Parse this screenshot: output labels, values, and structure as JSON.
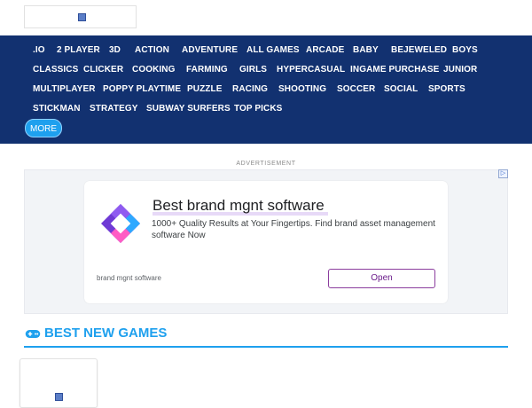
{
  "nav": {
    "items": [
      ".IO",
      "2 PLAYER",
      "3D",
      "ACTION",
      "ADVENTURE",
      "ALL GAMES",
      "ARCADE",
      "BABY",
      "BEJEWELED",
      "BOYS",
      "CLASSICS",
      "CLICKER",
      "COOKING",
      "FARMING",
      "GIRLS",
      "HYPERCASUAL",
      "INGAME PURCHASE",
      "JUNIOR",
      "MULTIPLAYER",
      "POPPY PLAYTIME",
      "PUZZLE",
      "RACING",
      "SHOOTING",
      "SOCCER",
      "SOCIAL",
      "SPORTS",
      "STICKMAN",
      "STRATEGY",
      "SUBWAY SURFERS",
      "TOP PICKS"
    ],
    "more_label": "MORE"
  },
  "ad": {
    "label": "ADVERTISEMENT",
    "choices_icon": "ad-choices-icon",
    "headline": "Best brand mgnt software",
    "description": "1000+ Quality Results at Your Fingertips. Find brand asset management software Now",
    "domain": "brand mgnt software",
    "cta": "Open"
  },
  "section": {
    "icon": "gamepad-icon",
    "title": "BEST NEW GAMES"
  },
  "colors": {
    "nav_background": "#123170",
    "accent": "#1ea0ee",
    "ad_button_border": "#8b3d9e"
  }
}
